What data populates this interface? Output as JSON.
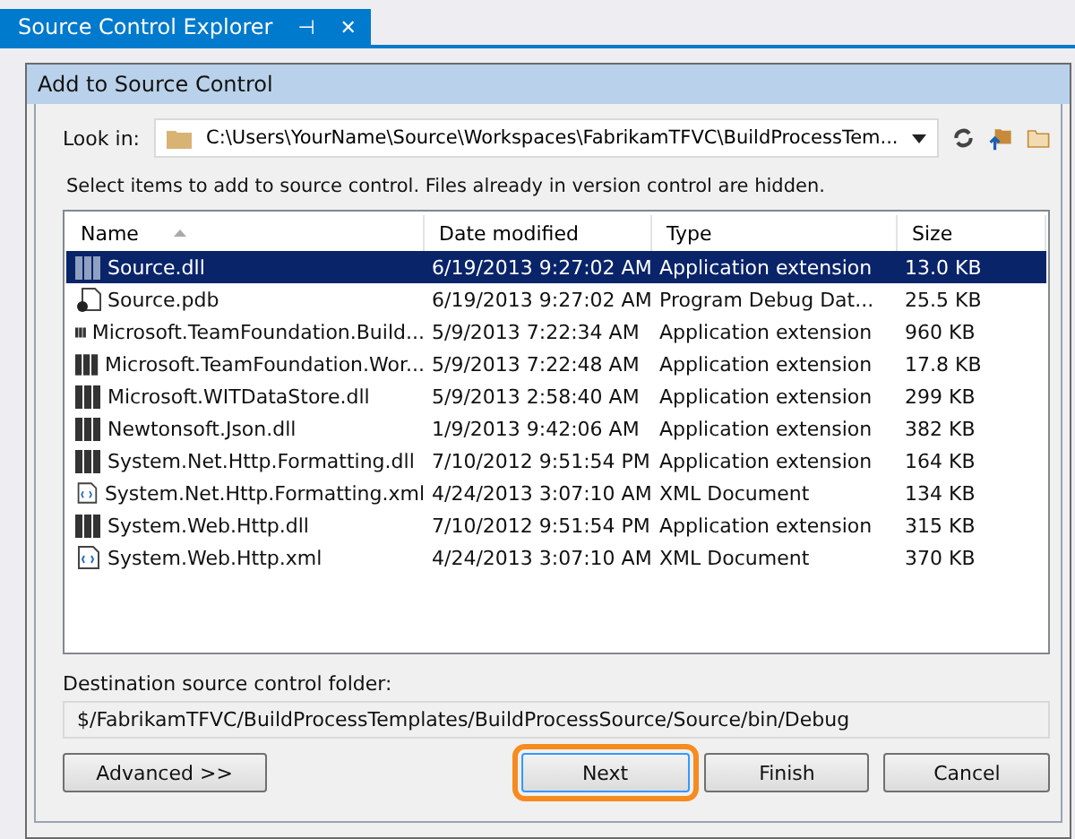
{
  "tab": {
    "title": "Source Control Explorer",
    "pin": "⊣",
    "close": "✕",
    "selected": true
  },
  "dialog": {
    "title": "Add to Source Control",
    "look_in": {
      "label": "Look in:",
      "value": "C:\\Users\\YourName\\Source\\Workspaces\\FabrikamTFVC\\BuildProcessTem..."
    },
    "instructions": "Select items to add to source control. Files already in version control are hidden.",
    "table": {
      "columns": [
        "Name",
        "Date modified",
        "Type",
        "Size"
      ],
      "rows": [
        {
          "kind": "dll",
          "name": "Source.dll",
          "date": "6/19/2013 9:27:02 AM",
          "type": "Application extension",
          "size": "13.0 KB",
          "selected": true
        },
        {
          "kind": "pdb",
          "name": "Source.pdb",
          "date": "6/19/2013 9:27:02 AM",
          "type": "Program Debug Dat...",
          "size": "25.5 KB",
          "selected": false
        },
        {
          "kind": "dll",
          "name": "Microsoft.TeamFoundation.Build...",
          "date": "5/9/2013 7:22:34 AM",
          "type": "Application extension",
          "size": "960 KB",
          "selected": false
        },
        {
          "kind": "dll",
          "name": "Microsoft.TeamFoundation.Wor...",
          "date": "5/9/2013 7:22:48 AM",
          "type": "Application extension",
          "size": "17.8 KB",
          "selected": false
        },
        {
          "kind": "dll",
          "name": "Microsoft.WITDataStore.dll",
          "date": "5/9/2013 2:58:40 AM",
          "type": "Application extension",
          "size": "299 KB",
          "selected": false
        },
        {
          "kind": "dll",
          "name": "Newtonsoft.Json.dll",
          "date": "1/9/2013 9:42:06 AM",
          "type": "Application extension",
          "size": "382 KB",
          "selected": false
        },
        {
          "kind": "dll",
          "name": "System.Net.Http.Formatting.dll",
          "date": "7/10/2012 9:51:54 PM",
          "type": "Application extension",
          "size": "164 KB",
          "selected": false
        },
        {
          "kind": "xml",
          "name": "System.Net.Http.Formatting.xml",
          "date": "4/24/2013 3:07:10 AM",
          "type": "XML Document",
          "size": "134 KB",
          "selected": false
        },
        {
          "kind": "dll",
          "name": "System.Web.Http.dll",
          "date": "7/10/2012 9:51:54 PM",
          "type": "Application extension",
          "size": "315 KB",
          "selected": false
        },
        {
          "kind": "xml",
          "name": "System.Web.Http.xml",
          "date": "4/24/2013 3:07:10 AM",
          "type": "XML Document",
          "size": "370 KB",
          "selected": false
        }
      ]
    },
    "destination": {
      "label": "Destination source control folder:",
      "value": "$/FabrikamTFVC/BuildProcessTemplates/BuildProcessSource/Source/bin/Debug"
    },
    "buttons": [
      {
        "label": "Advanced >>",
        "highlighted": false
      },
      {
        "label": "Next",
        "highlighted": true
      },
      {
        "label": "Finish",
        "highlighted": false
      },
      {
        "label": "Cancel",
        "highlighted": false
      }
    ]
  }
}
